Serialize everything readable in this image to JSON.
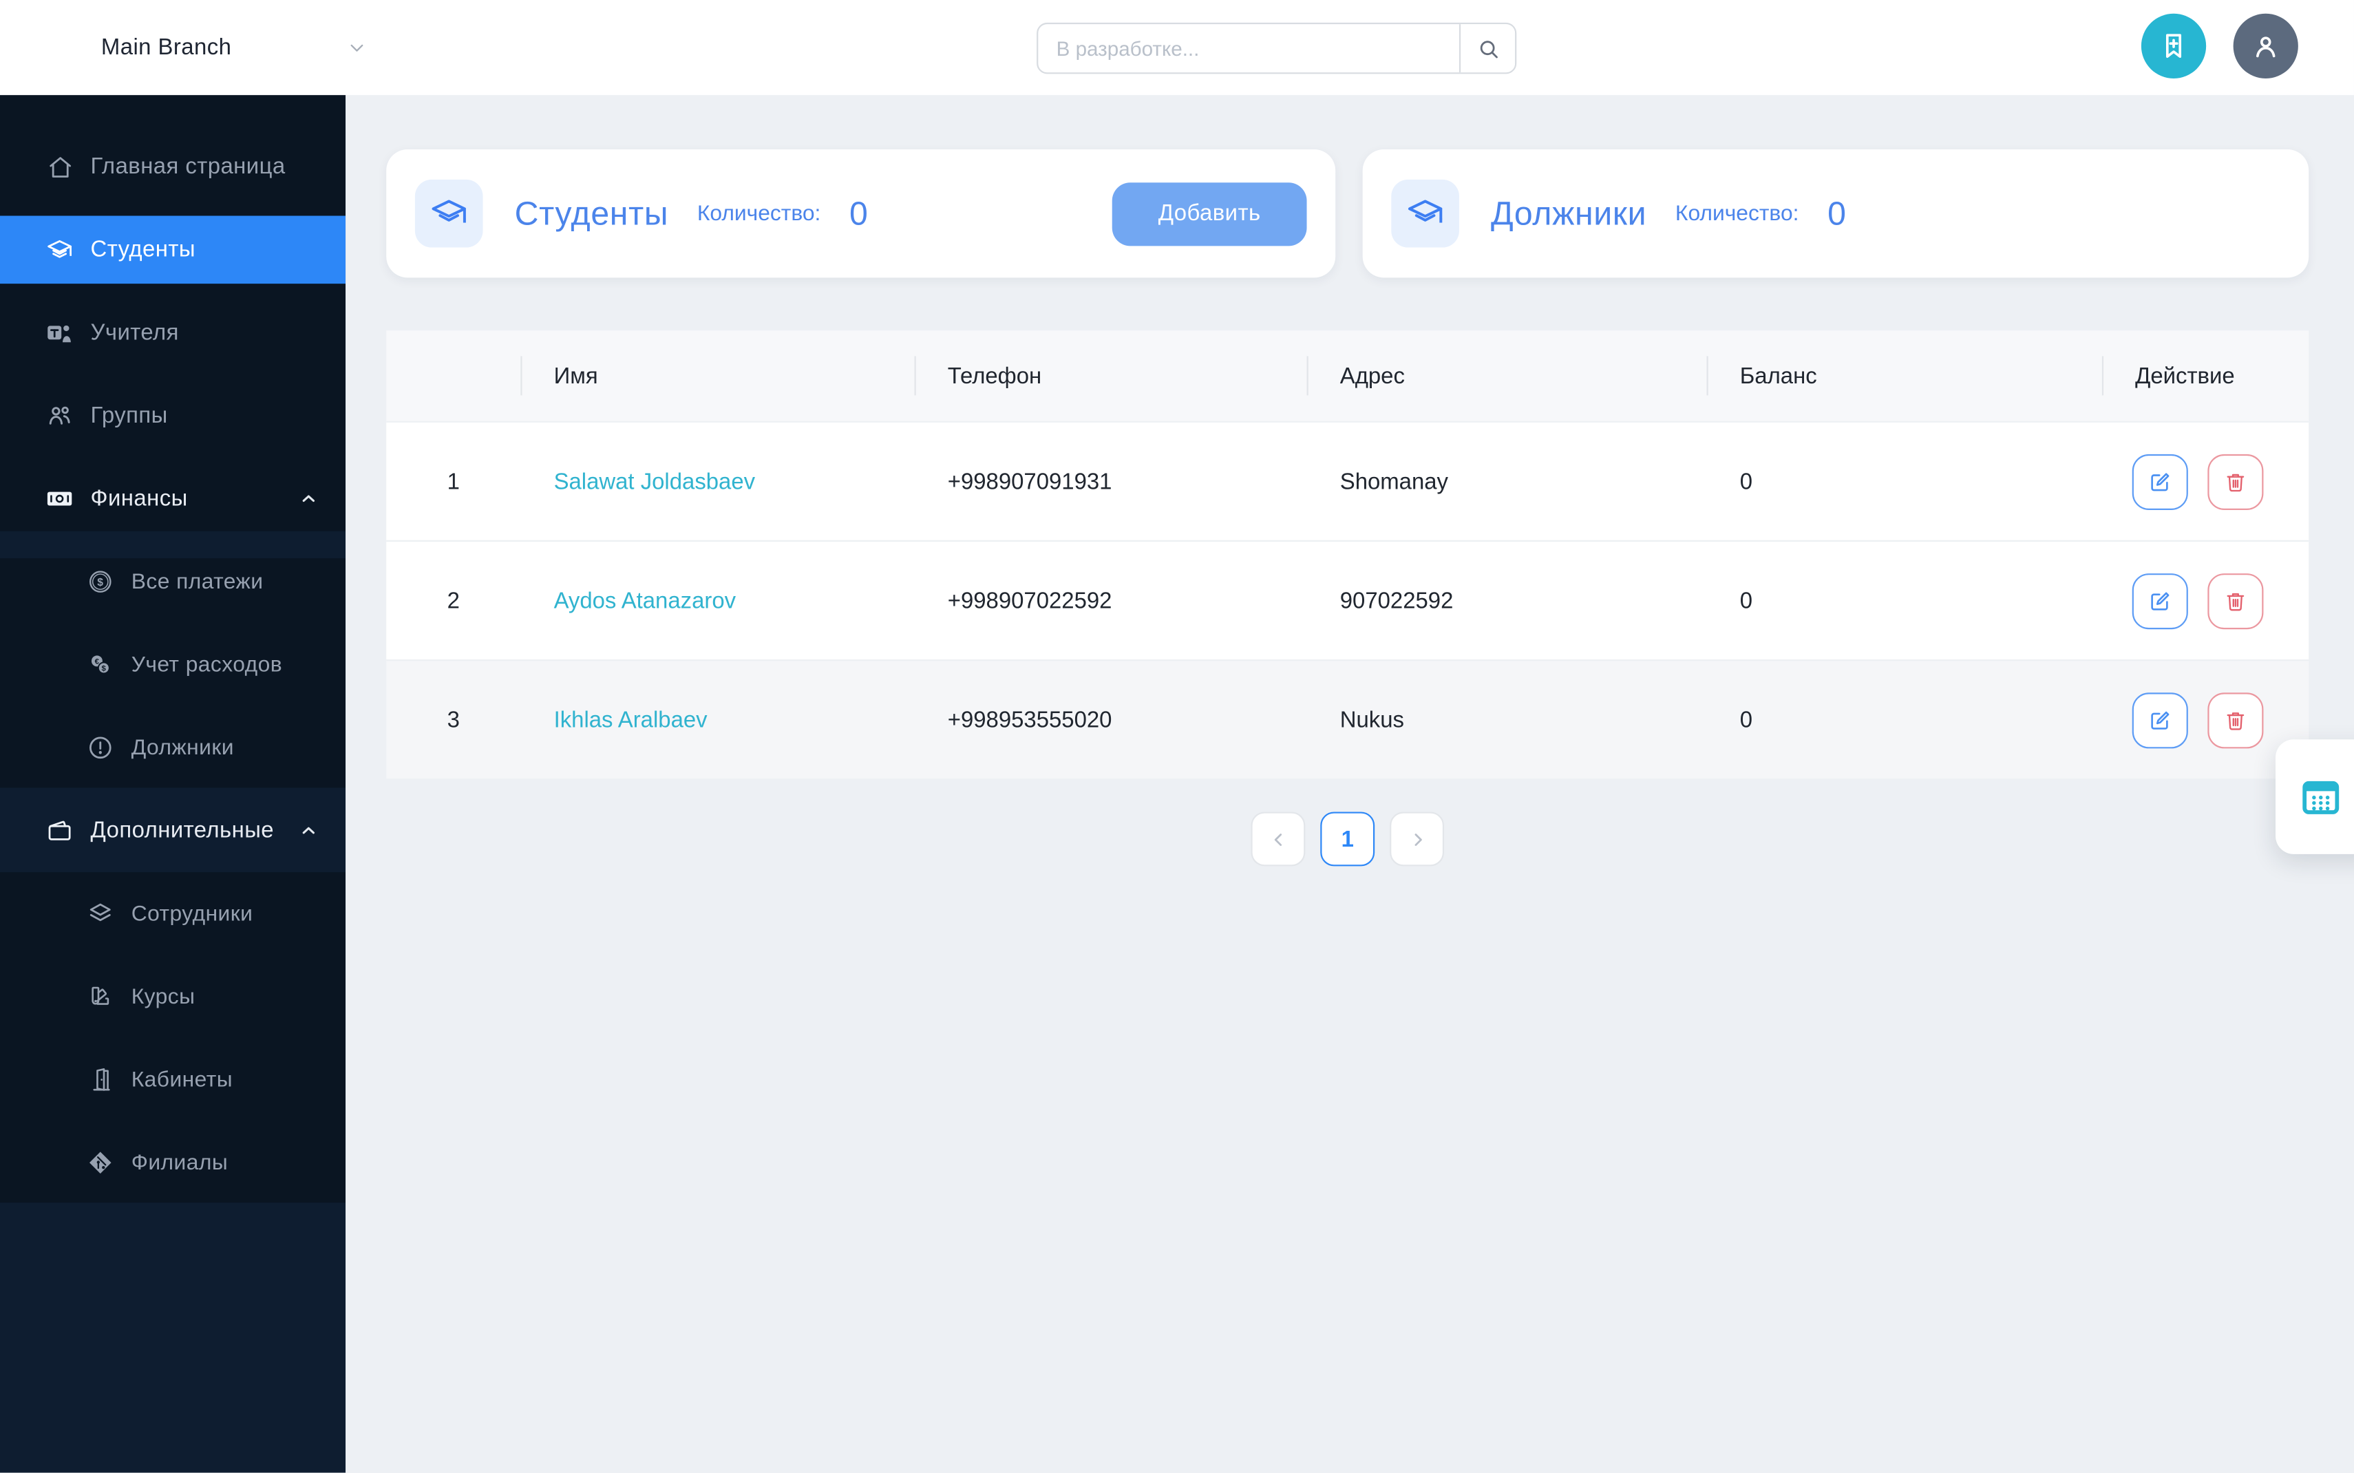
{
  "topbar": {
    "branch": "Main Branch",
    "search_placeholder": "В разработке..."
  },
  "sidebar": {
    "items": [
      {
        "label": "Главная страница",
        "icon": "home-icon"
      },
      {
        "label": "Студенты",
        "icon": "graduation-cap-icon",
        "active": true
      },
      {
        "label": "Учителя",
        "icon": "teams-icon"
      },
      {
        "label": "Группы",
        "icon": "people-icon"
      },
      {
        "label": "Финансы",
        "icon": "cash-icon",
        "expanded": true,
        "children": [
          {
            "label": "Все платежи",
            "icon": "dollar-coin-icon"
          },
          {
            "label": "Учет расходов",
            "icon": "coins-icon"
          },
          {
            "label": "Должники",
            "icon": "exclamation-circle-icon"
          }
        ]
      },
      {
        "label": "Дополнительные",
        "icon": "wallet-icon",
        "expanded": true,
        "children": [
          {
            "label": "Сотрудники",
            "icon": "layers-icon"
          },
          {
            "label": "Курсы",
            "icon": "swatch-icon"
          },
          {
            "label": "Кабинеты",
            "icon": "door-icon"
          },
          {
            "label": "Филиалы",
            "icon": "git-diamond-icon"
          }
        ]
      }
    ]
  },
  "cards": [
    {
      "title": "Студенты",
      "count_label": "Количество:",
      "count": "0",
      "button_label": "Добавить"
    },
    {
      "title": "Должники",
      "count_label": "Количество:",
      "count": "0"
    }
  ],
  "table": {
    "headers": {
      "name": "Имя",
      "phone": "Телефон",
      "address": "Адрес",
      "balance": "Баланс",
      "action": "Действие"
    },
    "rows": [
      {
        "index": "1",
        "name": "Salawat Joldasbaev",
        "phone": "+998907091931",
        "address": "Shomanay",
        "balance": "0"
      },
      {
        "index": "2",
        "name": "Aydos Atanazarov",
        "phone": "+998907022592",
        "address": "907022592",
        "balance": "0"
      },
      {
        "index": "3",
        "name": "Ikhlas Aralbaev",
        "phone": "+998953555020",
        "address": "Nukus",
        "balance": "0"
      }
    ]
  },
  "pagination": {
    "current": "1"
  },
  "colors": {
    "sidebar_bg": "#0e1d30",
    "sidebar_nav_bg": "#0a1522",
    "active_blue": "#2d87f7",
    "card_blue": "#4b84ea",
    "button_blue": "#72a7f2",
    "link_teal": "#30b3cf",
    "icon_teal": "#27b6d2",
    "avatar_gray": "#5c6a7e",
    "edit_blue": "#4a90f2",
    "danger_red": "#e35f6b",
    "page_bg": "#edf0f4"
  }
}
